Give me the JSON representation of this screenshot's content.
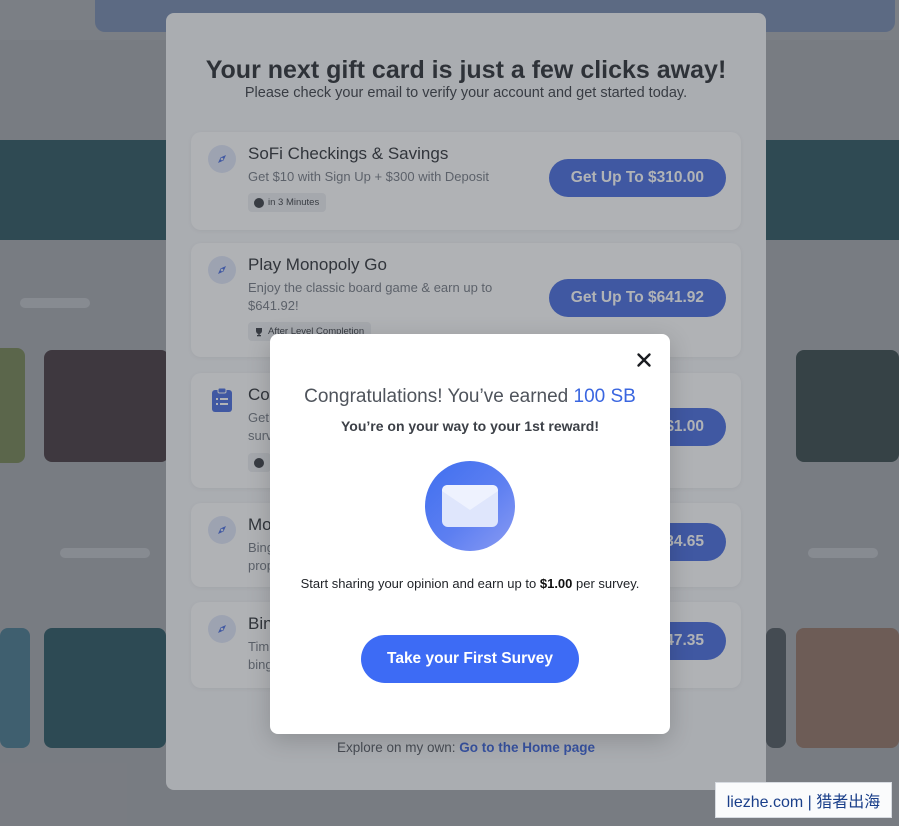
{
  "panel": {
    "title": "Your next gift card is just a few clicks away!",
    "subtitle": "Please check your email to verify your account and get started today.",
    "offers": [
      {
        "name": "SoFi Checkings & Savings",
        "desc": "Get $10 with Sign Up + $300 with Deposit",
        "tag": "in 3 Minutes",
        "tag_icon": "clock-icon",
        "button": "Get Up To $310.00",
        "icon": "compass-icon"
      },
      {
        "name": "Play Monopoly Go",
        "desc": "Enjoy the classic board game & earn up to $641.92!",
        "tag": "After Level Completion",
        "tag_icon": "trophy-icon",
        "button": "Get Up To $641.92",
        "icon": "compass-icon"
      },
      {
        "name": "Co",
        "desc": "Get\nsurv",
        "tag": "",
        "tag_icon": "clock-icon",
        "button": "$1.00",
        "icon": "clipboard-icon"
      },
      {
        "name": "Mo",
        "desc": "Bing\nprop",
        "button": "34.65",
        "icon": "compass-icon"
      },
      {
        "name": "Bin",
        "desc": "Tim\nbing",
        "button": "47.35",
        "icon": "compass-icon"
      }
    ],
    "footer_text": "Explore on my own:",
    "footer_link": "Go to the Home page"
  },
  "modal": {
    "congrats_prefix": "Congratulations! You’ve earned",
    "congrats_amount": "100 SB",
    "subtitle": "You’re on your way to your 1st reward!",
    "opinion_prefix": "Start sharing your opinion and earn up to",
    "opinion_amount": "$1.00",
    "opinion_suffix": "per survey.",
    "button": "Take your First Survey",
    "close_icon": "close-icon",
    "mail_icon": "envelope-icon"
  },
  "watermark": "liezhe.com | 猎者出海",
  "colors": {
    "accent": "#3d63dd",
    "link": "#2e59d9",
    "sb_highlight": "#3a66e0"
  }
}
